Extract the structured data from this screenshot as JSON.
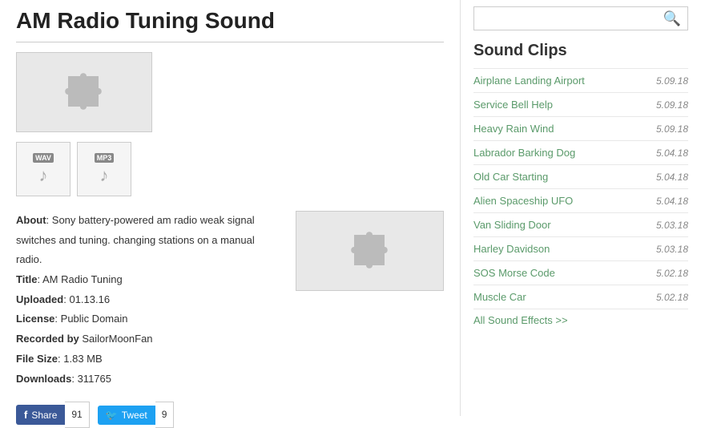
{
  "header": {
    "title": "AM Radio Tuning Sound"
  },
  "metadata": {
    "about_label": "About",
    "about_text": "Sony battery-powered am radio weak signal switches and tuning. changing stations on a manual radio.",
    "title_label": "Title",
    "title_value": "AM Radio Tuning",
    "uploaded_label": "Uploaded",
    "uploaded_value": "01.13.16",
    "license_label": "License",
    "license_value": "Public Domain",
    "recorded_label": "Recorded by",
    "recorded_value": "SailorMoonFan",
    "filesize_label": "File Size",
    "filesize_value": "1.83 MB",
    "downloads_label": "Downloads",
    "downloads_value": "311765"
  },
  "file_formats": [
    {
      "label": "WAV",
      "type": "wav"
    },
    {
      "label": "MP3",
      "type": "mp3"
    }
  ],
  "social": {
    "fb_label": "Share",
    "fb_count": "91",
    "tw_label": "Tweet",
    "tw_count": "9"
  },
  "sidebar": {
    "search_placeholder": "",
    "search_icon": "🔍",
    "clips_title": "Sound Clips",
    "clips": [
      {
        "name": "Airplane Landing Airport",
        "date": "5.09.18"
      },
      {
        "name": "Service Bell Help",
        "date": "5.09.18"
      },
      {
        "name": "Heavy Rain Wind",
        "date": "5.09.18"
      },
      {
        "name": "Labrador Barking Dog",
        "date": "5.04.18"
      },
      {
        "name": "Old Car Starting",
        "date": "5.04.18"
      },
      {
        "name": "Alien Spaceship UFO",
        "date": "5.04.18"
      },
      {
        "name": "Van Sliding Door",
        "date": "5.03.18"
      },
      {
        "name": "Harley Davidson",
        "date": "5.03.18"
      },
      {
        "name": "SOS Morse Code",
        "date": "5.02.18"
      },
      {
        "name": "Muscle Car",
        "date": "5.02.18"
      }
    ],
    "all_effects_label": "All Sound Effects >>"
  }
}
